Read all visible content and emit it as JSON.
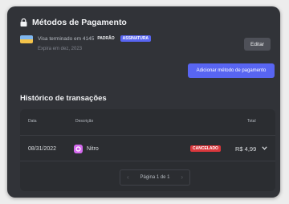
{
  "payment": {
    "title": "Métodos de Pagamento",
    "card": {
      "label": "Visa terminado em 4145",
      "badge_default": "PADRÃO",
      "badge_subscription": "ASSINATURA",
      "expires": "Expira em dez, 2023"
    },
    "edit_label": "Editar",
    "add_label": "Adicionar método de pagamento"
  },
  "history": {
    "title": "Histórico de transações",
    "columns": [
      "Data",
      "Descrição",
      "Total"
    ],
    "rows": [
      {
        "date": "08/31/2022",
        "description": "Nitro",
        "status": "CANCELADO",
        "total": "R$ 4,99"
      }
    ],
    "pagination": {
      "prev": "‹",
      "label": "Página 1 de 1",
      "next": "›"
    }
  },
  "colors": {
    "panel": "#313338",
    "accent": "#5865f2",
    "danger": "#da373c",
    "nitro": "#d56aef"
  },
  "icons": [
    "lock-icon",
    "visa-card-icon",
    "nitro-icon",
    "chevron-down-icon",
    "chevron-left-icon",
    "chevron-right-icon"
  ]
}
